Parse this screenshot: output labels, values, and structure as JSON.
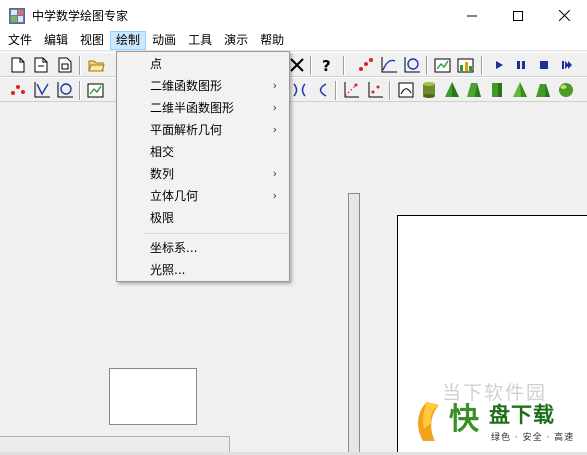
{
  "window": {
    "title": "中学数学绘图专家",
    "minimize_icon": "minimize-icon",
    "maximize_icon": "maximize-icon",
    "close_icon": "close-icon"
  },
  "menubar": {
    "items": [
      "文件",
      "编辑",
      "视图",
      "绘制",
      "动画",
      "工具",
      "演示",
      "帮助"
    ],
    "active_index": 3
  },
  "dropdown": {
    "items": [
      {
        "label": "点",
        "submenu": false
      },
      {
        "label": "二维函数图形",
        "submenu": true
      },
      {
        "label": "二维半函数图形",
        "submenu": true
      },
      {
        "label": "平面解析几何",
        "submenu": true
      },
      {
        "label": "相交",
        "submenu": false
      },
      {
        "label": "数列",
        "submenu": true
      },
      {
        "label": "立体几何",
        "submenu": true
      },
      {
        "label": "极限",
        "submenu": false
      },
      {
        "label": "坐标系...",
        "submenu": false
      },
      {
        "label": "光照...",
        "submenu": false
      }
    ],
    "arrow_glyph": "›"
  },
  "toolbar_icons": {
    "row1": [
      "new-doc-icon",
      "new-doc2-icon",
      "copy-doc-icon",
      "open-folder-icon",
      "delete-x-icon",
      "help-question-icon",
      "points-icon",
      "function-graph-icon",
      "refresh-circle-icon",
      "chart-edit-icon",
      "chart-green-icon",
      "play-icon",
      "pause-icon",
      "stop-icon",
      "skip-end-icon"
    ],
    "row2": [
      "scatter-points-icon",
      "axes-curve-icon",
      "circle-axes-icon",
      "chart-icon",
      "parenthesis-icon",
      "less-than-icon",
      "axes-plot-icon",
      "axes-plot2-icon",
      "square-icon",
      "cylinder-icon",
      "cone-icon",
      "prism-icon",
      "column-icon",
      "pyramid-icon",
      "frustum-icon",
      "sphere-icon"
    ]
  },
  "watermark": {
    "faint_text": "当下软件园",
    "logo_char": "快",
    "brand": "盘下载",
    "slogan": "绿色 · 安全 · 高速"
  },
  "colors": {
    "accent": "#0078d7",
    "menu_highlight": "#cce8ff",
    "brand_green": "#3a8f26"
  }
}
